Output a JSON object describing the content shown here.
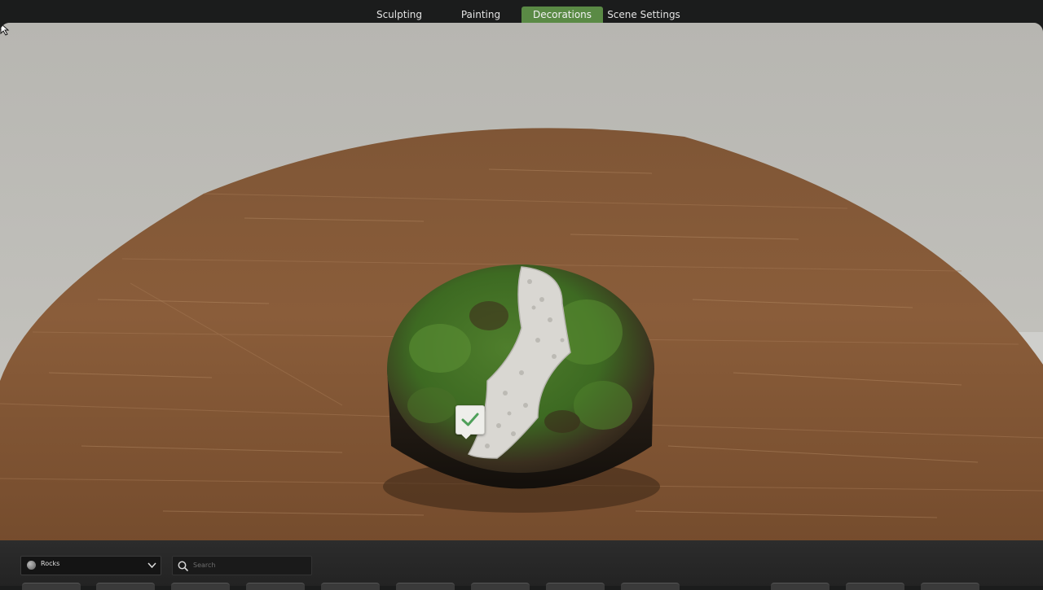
{
  "tabs": [
    {
      "label": "Sculpting"
    },
    {
      "label": "Painting"
    },
    {
      "label": "Decorations"
    },
    {
      "label": "Scene Settings"
    }
  ],
  "active_tab": "Decorations",
  "decorations_panel": {
    "category": {
      "label": "Rocks",
      "icon": "rock-icon"
    },
    "search": {
      "placeholder": "Search",
      "value": ""
    },
    "thumbnail_count": 12
  },
  "icons": [
    "rock-icon",
    "chevron-down-icon",
    "search-icon",
    "checkmark-icon",
    "cursor-icon"
  ],
  "colors": {
    "accent": "#5a8a45",
    "check": "#4fa05a",
    "background": "#1b1c1c"
  }
}
